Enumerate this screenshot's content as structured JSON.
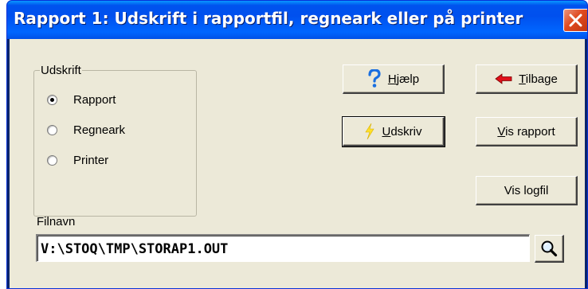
{
  "window": {
    "title": "Rapport 1: Udskrift i rapportfil, regneark eller på printer"
  },
  "group": {
    "legend": "Udskrift",
    "options": [
      {
        "label": "Rapport",
        "checked": true
      },
      {
        "label": "Regneark",
        "checked": false
      },
      {
        "label": "Printer",
        "checked": false
      }
    ]
  },
  "buttons": {
    "help": {
      "mnemonic": "H",
      "rest": "jælp",
      "icon": "question-icon"
    },
    "back": {
      "mnemonic": "T",
      "rest": "ilbage",
      "icon": "red-left-arrow-icon"
    },
    "print": {
      "mnemonic": "U",
      "rest": "dskriv",
      "icon": "lightning-icon"
    },
    "show_report": {
      "mnemonic": "V",
      "rest": "is rapport"
    },
    "show_log": {
      "label": "Vis logfil"
    }
  },
  "filename": {
    "label": "Filnavn",
    "value": "V:\\STOQ\\TMP\\STORAP1.OUT"
  },
  "colors": {
    "titlebar": "#0054e3",
    "face": "#ece9d8",
    "close": "#e04a20"
  }
}
